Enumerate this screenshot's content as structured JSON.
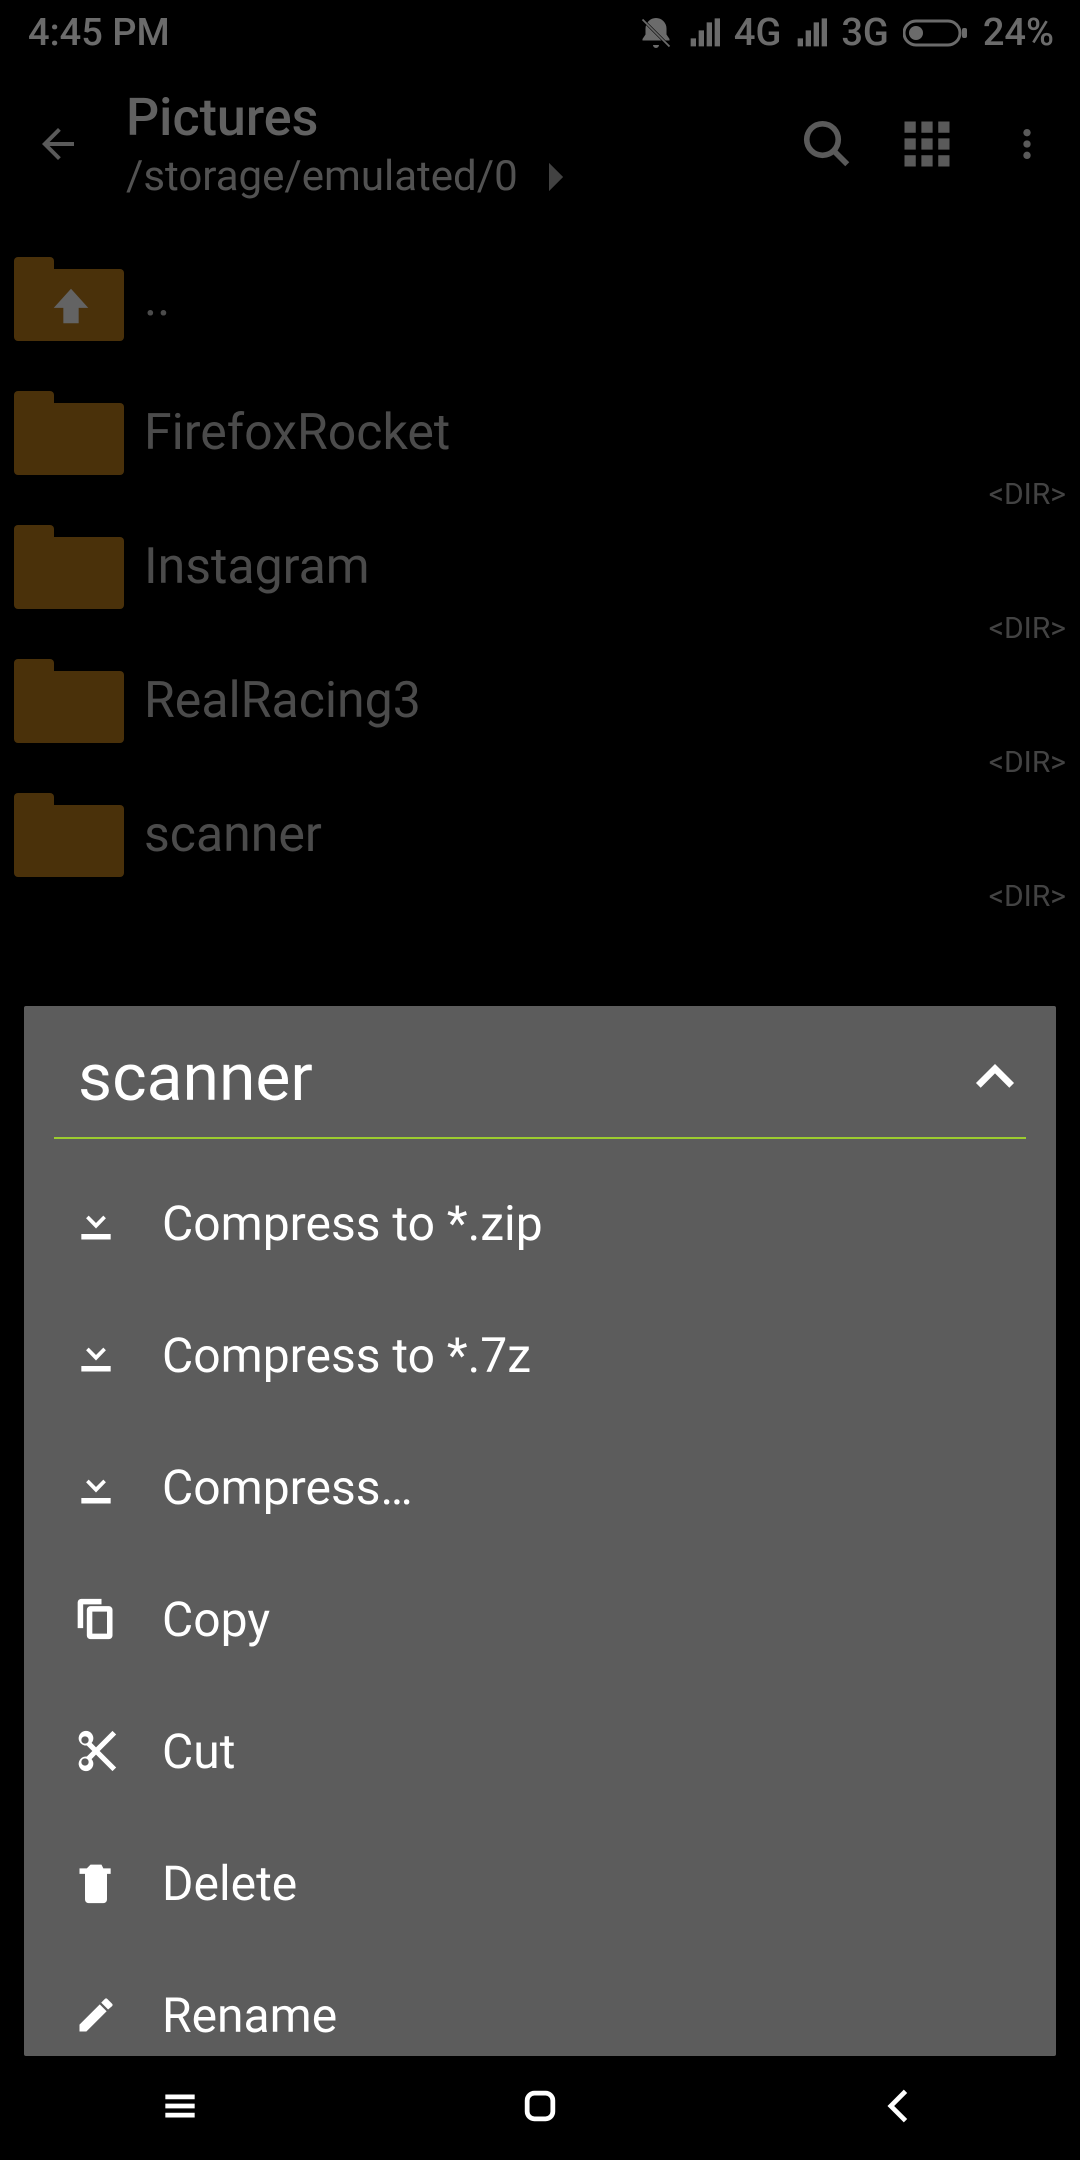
{
  "statusbar": {
    "time": "4:45 PM",
    "net1": "4G",
    "net2": "3G",
    "battery": "24%"
  },
  "appbar": {
    "title": "Pictures",
    "path": "/storage/emulated/0"
  },
  "folders": {
    "up": "..",
    "dir_tag": "<DIR>",
    "items": [
      {
        "name": "FirefoxRocket"
      },
      {
        "name": "Instagram"
      },
      {
        "name": "RealRacing3"
      },
      {
        "name": "scanner"
      }
    ]
  },
  "sheet": {
    "title": "scanner",
    "items": [
      {
        "label": "Compress to *.zip"
      },
      {
        "label": "Compress to *.7z"
      },
      {
        "label": "Compress…"
      },
      {
        "label": "Copy"
      },
      {
        "label": "Cut"
      },
      {
        "label": "Delete"
      },
      {
        "label": "Rename"
      }
    ]
  }
}
